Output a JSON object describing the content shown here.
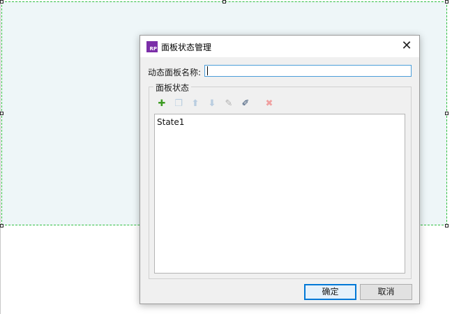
{
  "dialog": {
    "title": "面板状态管理",
    "app_icon_text": "RP",
    "close_glyph": "✕",
    "panel_name_label": "动态面板名称:",
    "panel_name_value": "",
    "group_label": "面板状态",
    "toolbar": [
      {
        "name": "add-state-icon",
        "glyph": "✚",
        "color": "#3c9b22",
        "enabled": true
      },
      {
        "name": "duplicate-state-icon",
        "glyph": "❐",
        "color": "#b9cde0",
        "enabled": false
      },
      {
        "name": "move-up-icon",
        "glyph": "⬆",
        "color": "#b9cde0",
        "enabled": false
      },
      {
        "name": "move-down-icon",
        "glyph": "⬇",
        "color": "#b9cde0",
        "enabled": false
      },
      {
        "name": "edit-state-icon",
        "glyph": "✎",
        "color": "#b0b0b0",
        "enabled": false
      },
      {
        "name": "edit-all-states-icon",
        "glyph": "✐",
        "color": "#2f4a6d",
        "enabled": true
      },
      {
        "name": "delete-state-icon",
        "glyph": "✖",
        "color": "#f0a0a0",
        "enabled": false
      }
    ],
    "states": [
      "State1"
    ],
    "ok_label": "确定",
    "cancel_label": "取消"
  },
  "colors": {
    "panel_fill": "#eef6f8",
    "selection_border": "#2fbf3f",
    "input_focus": "#4c9ed9",
    "ok_button_border": "#0078d7"
  }
}
